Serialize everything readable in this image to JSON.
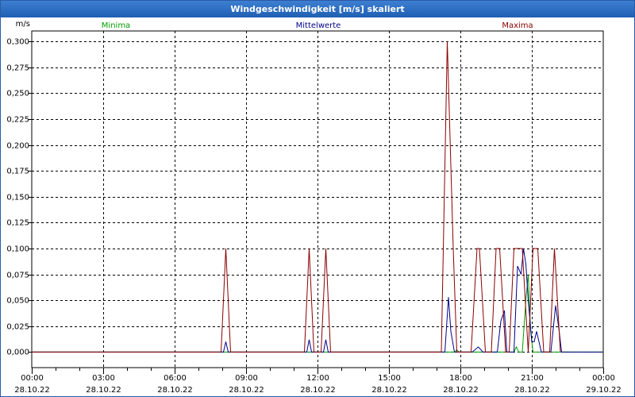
{
  "window": {
    "title": "Windgeschwindigkeit [m/s] skaliert"
  },
  "colors": {
    "minima": "#00a000",
    "mittelwerte": "#00008b",
    "maxima": "#8b0000",
    "grid": "#000000",
    "titlebar": "#1f5fb3"
  },
  "chart_data": {
    "type": "line",
    "title": "Windgeschwindigkeit [m/s] skaliert",
    "ylabel": "m/s",
    "xlabel": "",
    "ylim": [
      -0.015,
      0.31
    ],
    "xlim": [
      0,
      24
    ],
    "grid": true,
    "legend_placement": "top",
    "y_ticks": [
      {
        "value": 0.0,
        "label": "0,000"
      },
      {
        "value": 0.025,
        "label": "0,025"
      },
      {
        "value": 0.05,
        "label": "0,050"
      },
      {
        "value": 0.075,
        "label": "0,075"
      },
      {
        "value": 0.1,
        "label": "0,100"
      },
      {
        "value": 0.125,
        "label": "0,125"
      },
      {
        "value": 0.15,
        "label": "0,150"
      },
      {
        "value": 0.175,
        "label": "0,175"
      },
      {
        "value": 0.2,
        "label": "0,200"
      },
      {
        "value": 0.225,
        "label": "0,225"
      },
      {
        "value": 0.25,
        "label": "0,250"
      },
      {
        "value": 0.275,
        "label": "0,275"
      },
      {
        "value": 0.3,
        "label": "0,300"
      }
    ],
    "x_ticks": [
      {
        "hours": 0,
        "time": "00:00",
        "date": "28.10.22"
      },
      {
        "hours": 3,
        "time": "03:00",
        "date": "28.10.22"
      },
      {
        "hours": 6,
        "time": "06:00",
        "date": "28.10.22"
      },
      {
        "hours": 9,
        "time": "09:00",
        "date": "28.10.22"
      },
      {
        "hours": 12,
        "time": "12:00",
        "date": "28.10.22"
      },
      {
        "hours": 15,
        "time": "15:00",
        "date": "28.10.22"
      },
      {
        "hours": 18,
        "time": "18:00",
        "date": "28.10.22"
      },
      {
        "hours": 21,
        "time": "21:00",
        "date": "28.10.22"
      },
      {
        "hours": 24,
        "time": "00:00",
        "date": "29.10.22"
      }
    ],
    "series": [
      {
        "name": "Minima",
        "color": "#00a000",
        "points": [
          [
            0,
            0
          ],
          [
            17.75,
            0
          ],
          [
            17.85,
            0.002
          ],
          [
            17.95,
            0
          ],
          [
            20.25,
            0
          ],
          [
            20.35,
            0.005
          ],
          [
            20.45,
            0
          ],
          [
            20.6,
            0
          ],
          [
            20.75,
            0.05
          ],
          [
            20.85,
            0.075
          ],
          [
            20.95,
            0.02
          ],
          [
            21.05,
            0
          ],
          [
            24,
            0
          ]
        ]
      },
      {
        "name": "Mittelwerte",
        "color": "#00008b",
        "points": [
          [
            0,
            0
          ],
          [
            8.05,
            0
          ],
          [
            8.15,
            0.01
          ],
          [
            8.25,
            0
          ],
          [
            11.55,
            0
          ],
          [
            11.65,
            0.012
          ],
          [
            11.75,
            0
          ],
          [
            12.25,
            0
          ],
          [
            12.35,
            0.012
          ],
          [
            12.45,
            0
          ],
          [
            17.35,
            0
          ],
          [
            17.5,
            0.053
          ],
          [
            17.6,
            0.02
          ],
          [
            17.75,
            0
          ],
          [
            18.5,
            0
          ],
          [
            18.75,
            0.005
          ],
          [
            18.95,
            0
          ],
          [
            19.2,
            0
          ],
          [
            19.55,
            0
          ],
          [
            19.7,
            0.03
          ],
          [
            19.85,
            0.04
          ],
          [
            19.95,
            0
          ],
          [
            20.25,
            0
          ],
          [
            20.4,
            0.083
          ],
          [
            20.55,
            0.075
          ],
          [
            20.65,
            0.1
          ],
          [
            20.75,
            0.085
          ],
          [
            20.85,
            0.05
          ],
          [
            21.0,
            0.01
          ],
          [
            21.1,
            0.01
          ],
          [
            21.2,
            0.02
          ],
          [
            21.4,
            0
          ],
          [
            21.8,
            0
          ],
          [
            22.0,
            0.045
          ],
          [
            22.15,
            0.02
          ],
          [
            22.25,
            0
          ],
          [
            24,
            0
          ]
        ]
      },
      {
        "name": "Maxima",
        "color": "#8b0000",
        "points": [
          [
            0,
            0
          ],
          [
            7.95,
            0
          ],
          [
            8.15,
            0.1
          ],
          [
            8.35,
            0
          ],
          [
            11.45,
            0
          ],
          [
            11.65,
            0.1
          ],
          [
            11.85,
            0
          ],
          [
            12.15,
            0
          ],
          [
            12.35,
            0.1
          ],
          [
            12.55,
            0
          ],
          [
            17.2,
            0
          ],
          [
            17.45,
            0.3
          ],
          [
            17.7,
            0.1
          ],
          [
            17.85,
            0
          ],
          [
            18.45,
            0
          ],
          [
            18.7,
            0.1
          ],
          [
            18.8,
            0.1
          ],
          [
            19.05,
            0
          ],
          [
            19.3,
            0
          ],
          [
            19.5,
            0.1
          ],
          [
            19.65,
            0.1
          ],
          [
            19.9,
            0
          ],
          [
            20.05,
            0
          ],
          [
            20.25,
            0.1
          ],
          [
            20.6,
            0.1
          ],
          [
            20.85,
            0
          ],
          [
            21.05,
            0.1
          ],
          [
            21.25,
            0.1
          ],
          [
            21.5,
            0
          ],
          [
            21.75,
            0
          ],
          [
            21.95,
            0.1
          ],
          [
            22.2,
            0
          ]
        ]
      }
    ]
  }
}
